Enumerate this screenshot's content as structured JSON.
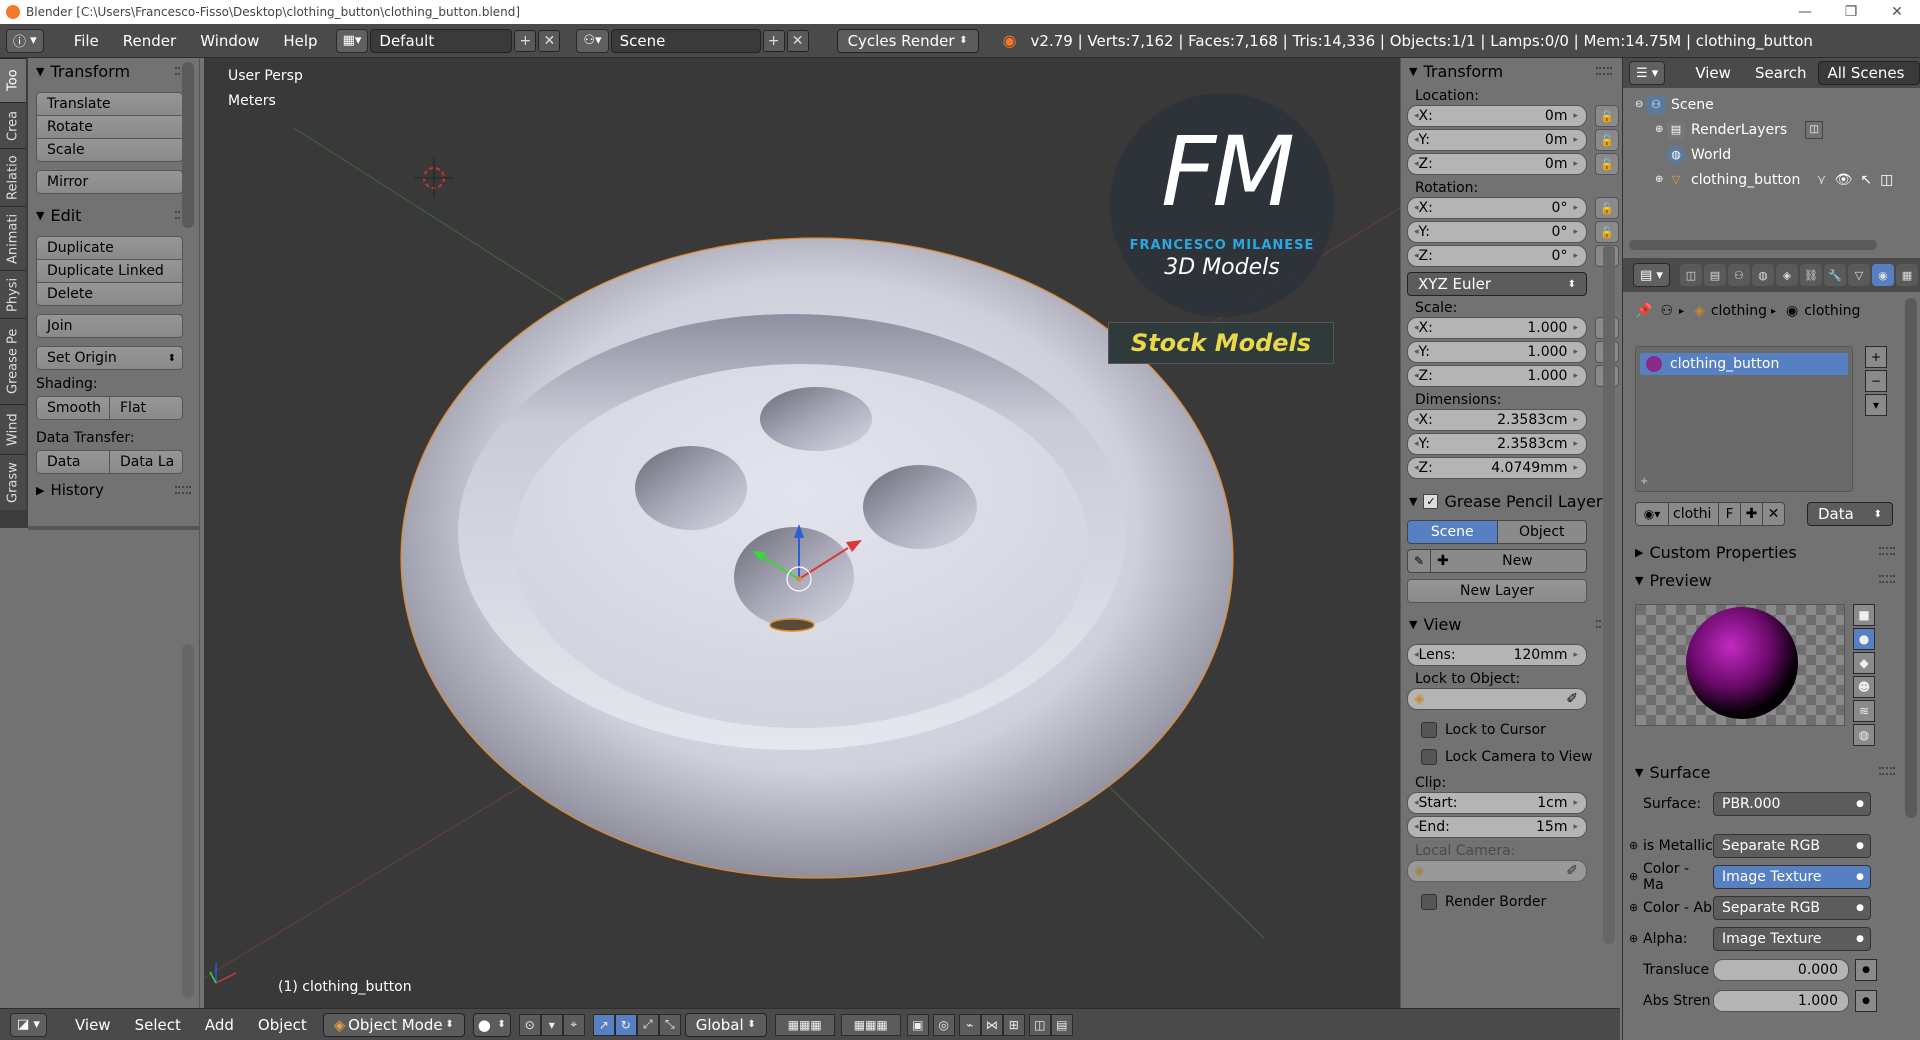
{
  "titlebar": {
    "title": "Blender [C:\\Users\\Francesco-Fisso\\Desktop\\clothing_button\\clothing_button.blend]",
    "minimize": "—",
    "maximize": "❐",
    "close": "✕"
  },
  "info": {
    "menus": [
      "File",
      "Render",
      "Window",
      "Help"
    ],
    "screen_layout": "Default",
    "scene": "Scene",
    "render_engine": "Cycles Render",
    "stats": "v2.79 | Verts:7,162 | Faces:7,168 | Tris:14,336 | Objects:1/1 | Lamps:0/0 | Mem:14.75M | clothing_button"
  },
  "left_tabs": [
    "Too",
    "Crea",
    "Relatio",
    "Animati",
    "Physi",
    "Grease Pe",
    "Wind",
    "Grasw"
  ],
  "toolshelf": {
    "transform_title": "Transform",
    "transform_buttons": [
      "Translate",
      "Rotate",
      "Scale"
    ],
    "mirror": "Mirror",
    "edit_title": "Edit",
    "edit_buttons": [
      "Duplicate",
      "Duplicate Linked",
      "Delete"
    ],
    "join": "Join",
    "set_origin": "Set Origin",
    "shading_label": "Shading:",
    "smooth": "Smooth",
    "flat": "Flat",
    "data_transfer_label": "Data Transfer:",
    "data": "Data",
    "data_layout": "Data La",
    "history_title": "History"
  },
  "viewport": {
    "view_name": "User Persp",
    "units": "Meters",
    "object_label": "(1) clothing_button",
    "watermark_initials": "FM",
    "watermark_brand": "FRANCESCO MILANESE",
    "watermark_sub": "3D Models",
    "watermark_banner": "Stock Models"
  },
  "view_header": {
    "menus": [
      "View",
      "Select",
      "Add",
      "Object"
    ],
    "mode": "Object Mode",
    "orientation": "Global"
  },
  "npanel": {
    "transform_title": "Transform",
    "location_label": "Location:",
    "location": [
      {
        "axis": "X:",
        "value": "0m"
      },
      {
        "axis": "Y:",
        "value": "0m"
      },
      {
        "axis": "Z:",
        "value": "0m"
      }
    ],
    "rotation_label": "Rotation:",
    "rotation": [
      {
        "axis": "X:",
        "value": "0°"
      },
      {
        "axis": "Y:",
        "value": "0°"
      },
      {
        "axis": "Z:",
        "value": "0°"
      }
    ],
    "rotation_mode": "XYZ Euler",
    "scale_label": "Scale:",
    "scale": [
      {
        "axis": "X:",
        "value": "1.000"
      },
      {
        "axis": "Y:",
        "value": "1.000"
      },
      {
        "axis": "Z:",
        "value": "1.000"
      }
    ],
    "dimensions_label": "Dimensions:",
    "dimensions": [
      {
        "axis": "X:",
        "value": "2.3583cm"
      },
      {
        "axis": "Y:",
        "value": "2.3583cm"
      },
      {
        "axis": "Z:",
        "value": "4.0749mm"
      }
    ],
    "grease_title": "Grease Pencil Layer",
    "grease_scene": "Scene",
    "grease_object": "Object",
    "grease_new": "New",
    "grease_new_layer": "New Layer",
    "view_title": "View",
    "lens_label": "Lens:",
    "lens_value": "120mm",
    "lock_object_label": "Lock to Object:",
    "lock_cursor": "Lock to Cursor",
    "lock_camera": "Lock Camera to View",
    "clip_label": "Clip:",
    "clip_start_label": "Start:",
    "clip_start": "1cm",
    "clip_end_label": "End:",
    "clip_end": "15m",
    "local_camera_label": "Local Camera:",
    "render_border": "Render Border"
  },
  "outliner": {
    "view": "View",
    "search": "Search",
    "filter": "All Scenes",
    "items": [
      "Scene",
      "RenderLayers",
      "World",
      "clothing_button"
    ]
  },
  "properties": {
    "breadcrumb": [
      "clothing",
      "clothing"
    ],
    "material_slot": "clothing_button",
    "material_name": "clothi",
    "fake_user": "F",
    "link": "Data",
    "custom_props": "Custom Properties",
    "preview": "Preview",
    "surface_title": "Surface",
    "surface_label": "Surface:",
    "surface_value": "PBR.000",
    "inputs": [
      {
        "label": "is Metallic",
        "value": "Separate RGB"
      },
      {
        "label": "Color - Ma",
        "value": "Image Texture"
      },
      {
        "label": "Color - Ab",
        "value": "Separate RGB"
      },
      {
        "label": "Alpha:",
        "value": "Image Texture"
      }
    ],
    "translucence_label": "Transluce",
    "translucence_value": "0.000",
    "translucence_fill": 0.0,
    "abs_strength_label": "Abs Stren",
    "abs_strength_value": "1.000",
    "abs_strength_fill": 1.0
  },
  "colors": {
    "accent": "#5680c2",
    "header": "#4a4a4a",
    "panel": "#727272",
    "viewport": "#393939",
    "watermark_blue": "#2aa8e0",
    "watermark_yellow": "#e8d84a"
  }
}
